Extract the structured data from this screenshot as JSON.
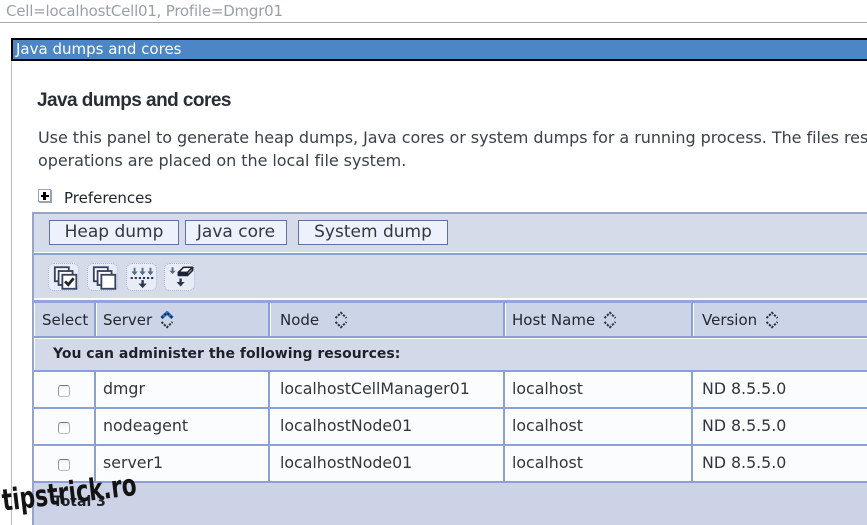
{
  "page": {
    "breadcrumb": "Cell=localhostCell01, Profile=Dmgr01"
  },
  "panel": {
    "title": "Java dumps and cores"
  },
  "content": {
    "heading": "Java dumps and cores",
    "description_line1": "Use this panel to generate heap dumps, Java cores or system dumps for a running process. The files resulting from these",
    "description_line2": "operations are placed on the local file system.",
    "preferences_label": "Preferences"
  },
  "actions": {
    "buttons": [
      "Heap dump",
      "Java core",
      "System dump"
    ],
    "icons": [
      "select-all-icon",
      "deselect-all-icon",
      "show-filter-icon",
      "hide-filter-icon"
    ]
  },
  "table": {
    "columns": [
      {
        "label": "Select",
        "sortable": false
      },
      {
        "label": "Server",
        "sortable": true,
        "sorted": "ascending"
      },
      {
        "label": "Node",
        "sortable": true,
        "sorted": "none"
      },
      {
        "label": "Host Name",
        "sortable": true,
        "sorted": "none"
      },
      {
        "label": "Version",
        "sortable": true,
        "sorted": "none"
      }
    ],
    "info_row": "You can administer the following resources:",
    "rows": [
      {
        "server": "dmgr",
        "node": "localhostCellManager01",
        "host": "localhost",
        "version": "ND 8.5.5.0",
        "checked": false
      },
      {
        "server": "nodeagent",
        "node": "localhostNode01",
        "host": "localhost",
        "version": "ND 8.5.5.0",
        "checked": false
      },
      {
        "server": "server1",
        "node": "localhostNode01",
        "host": "localhost",
        "version": "ND 8.5.5.0",
        "checked": false
      }
    ],
    "total_label": "Total 3"
  },
  "watermark": "tipstrick.ro",
  "colors": {
    "titlebar_bg": "#4c86c5",
    "table_bg": "#d8deec",
    "header_bg": "#ccd4e8",
    "grid_border": "#8da1cf",
    "sorted_arrow": "#2f75c4"
  }
}
